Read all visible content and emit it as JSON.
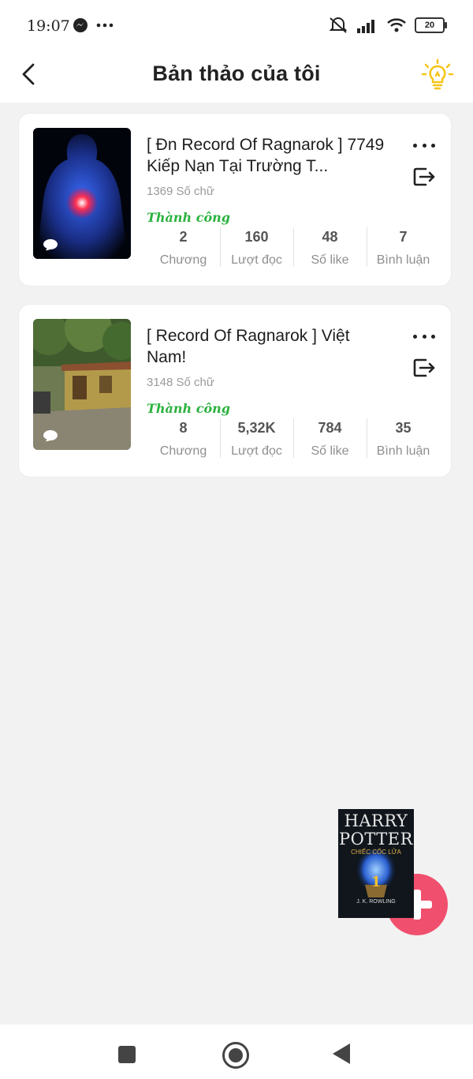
{
  "status_bar": {
    "time": "19:07",
    "battery": "20"
  },
  "header": {
    "title": "Bản thảo của tôi"
  },
  "works": [
    {
      "title": "[ Đn Record Of Ragnarok ] 7749 Kiếp Nạn Tại Trường T...",
      "word_count": "1369 Số chữ",
      "status": "Thành công",
      "stats": [
        {
          "value": "2",
          "label": "Chương"
        },
        {
          "value": "160",
          "label": "Lượt đọc"
        },
        {
          "value": "48",
          "label": "Số like"
        },
        {
          "value": "7",
          "label": "Bình luận"
        }
      ]
    },
    {
      "title": "[ Record Of Ragnarok ] Việt Nam!",
      "word_count": "3148 Số chữ",
      "status": "Thành công",
      "stats": [
        {
          "value": "8",
          "label": "Chương"
        },
        {
          "value": "5,32K",
          "label": "Lượt đọc"
        },
        {
          "value": "784",
          "label": "Số like"
        },
        {
          "value": "35",
          "label": "Bình luận"
        }
      ]
    }
  ],
  "floating_book": {
    "title_line1": "HARRY",
    "title_line2": "POTTER",
    "subtitle": "CHIẾC CỐC LỬA",
    "author": "J. K. ROWLING"
  },
  "colors": {
    "accent_fab": "#f0506e",
    "success": "#2bb23f",
    "bulb": "#f5c518"
  }
}
